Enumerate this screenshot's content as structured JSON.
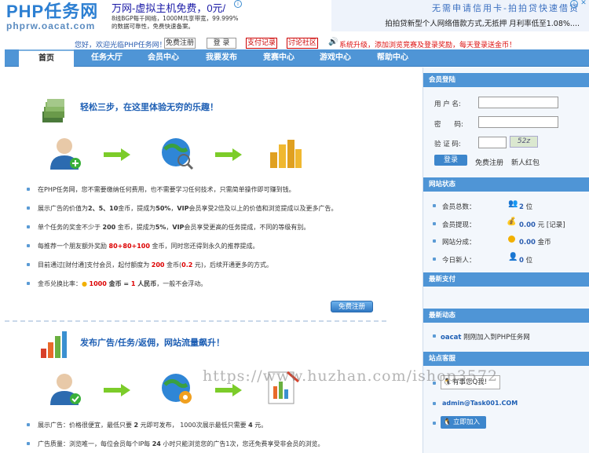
{
  "header": {
    "logo_main": "PHP任务网",
    "logo_sub": "phprw.oacat.com",
    "ad_left": {
      "title": "万网-虚拟主机免费，0元/",
      "desc1": "8线BGP每千网络，1000M共享带宽，99.999%",
      "desc2": "的数据可靠性，免费快速备案。"
    },
    "ad_right": {
      "title": "无需申请信用卡-拍拍贷快速借贷",
      "desc": "拍拍贷新型个人网络借款方式,无抵押 月利率低至1.08%...."
    }
  },
  "topbar": {
    "welcome": "您好，欢迎光临PHP任务网！",
    "register": "免费注册",
    "login": "登 录",
    "pay_record": "支付记录",
    "forum": "讨论社区",
    "notice": "系统升级，添加浏览竞赛及登录奖励，每天登录送金币！"
  },
  "nav": {
    "items": [
      "首页",
      "任务大厅",
      "会员中心",
      "我要发布",
      "竞赛中心",
      "游戏中心",
      "帮助中心"
    ]
  },
  "main": {
    "section1_title": "轻松三步，在这里体验无穷的乐趣！",
    "section1_points": [
      {
        "parts": [
          [
            "在PHP任务网，您不需要缴纳任何费用，也不需要学习任何技术，只需简单操作即可赚到钱。",
            ""
          ]
        ]
      },
      {
        "parts": [
          [
            "展示广告的价值为",
            ""
          ],
          [
            "2、5、10",
            "b"
          ],
          [
            "金币，提成为",
            ""
          ],
          [
            "50%",
            "b"
          ],
          [
            "，",
            ""
          ],
          [
            "VIP",
            "b"
          ],
          [
            "会员享受2倍及以上的价值和浏览提成以及更多广告。",
            ""
          ]
        ]
      },
      {
        "parts": [
          [
            "单个任务的奖金不少于 ",
            ""
          ],
          [
            "200",
            "b"
          ],
          [
            " 金币，提成为",
            ""
          ],
          [
            "5%",
            "b"
          ],
          [
            "，",
            ""
          ],
          [
            "VIP",
            "b"
          ],
          [
            "会员享受更高的任务提成，不同的等级有别。",
            ""
          ]
        ]
      },
      {
        "parts": [
          [
            "每推荐一个朋友额外奖励 ",
            ""
          ],
          [
            "80+80+100",
            "r"
          ],
          [
            " 金币，同时您还得到永久的推荐提成。",
            ""
          ]
        ]
      },
      {
        "parts": [
          [
            "目前通过[财付通]支付会员，起付额度为 ",
            ""
          ],
          [
            "200",
            "r"
          ],
          [
            " 金币(",
            ""
          ],
          [
            "0.2",
            "r"
          ],
          [
            " 元)，后续开通更多的方式。",
            ""
          ]
        ]
      },
      {
        "parts": [
          [
            "金币兑换比率：",
            ""
          ],
          [
            "● ",
            "c"
          ],
          [
            "1000",
            "r"
          ],
          [
            " 金币 = ",
            "b"
          ],
          [
            "1",
            "r"
          ],
          [
            " 人民币",
            "b"
          ],
          [
            "，一般不会浮动。",
            ""
          ]
        ]
      }
    ],
    "register_btn": "免费注册",
    "section2_title": "发布广告/任务/返佣，网站流量飙升！",
    "section2_points": [
      {
        "parts": [
          [
            "展示广告：价格很便宜，最低只要 ",
            ""
          ],
          [
            "2",
            "b"
          ],
          [
            " 元即可发布， 1000次展示最低只需要 ",
            ""
          ],
          [
            "4",
            "b"
          ],
          [
            " 元。",
            ""
          ]
        ]
      },
      {
        "parts": [
          [
            "广告质量：浏览唯一，每位会员每个IP每 ",
            ""
          ],
          [
            "24",
            "b"
          ],
          [
            " 小时只能浏览您的广告1次，您还免费享受非会员的浏览。",
            ""
          ]
        ]
      }
    ],
    "watermark": "https://www.huzhan.com/ishop3572"
  },
  "sidebar": {
    "login": {
      "title": "会员登陆",
      "username_label": "用 户 名:",
      "password_label": "密　　码:",
      "captcha_label": "验 证 码:",
      "captcha_text": "52z",
      "login_btn": "登录",
      "register_link": "免费注册",
      "newbie_link": "新人红包"
    },
    "status": {
      "title": "网站状态",
      "rows": [
        {
          "label": "会员总数：",
          "value": "2",
          "unit": " 位",
          "extra": ""
        },
        {
          "label": "会员提现：",
          "value": "0.00",
          "unit": " 元",
          "extra": " [记录]"
        },
        {
          "label": "网站分成：",
          "value": "0.00",
          "unit": " 金币",
          "extra": ""
        },
        {
          "label": "今日新人：",
          "value": "0",
          "unit": " 位",
          "extra": ""
        }
      ]
    },
    "latest_pay": {
      "title": "最新支付"
    },
    "latest_news": {
      "title": "最新动态",
      "item_user": "oacat",
      "item_text": " 刚刚加入到PHP任务网"
    },
    "service": {
      "title": "站点客服",
      "qq_label": "有事您Q我!",
      "email": "admin@Task001.COM",
      "join_btn": "立即加入"
    }
  },
  "colors": {
    "accent": "#4f95d6",
    "link": "#1e5fb4",
    "highlight": "#d00000"
  }
}
